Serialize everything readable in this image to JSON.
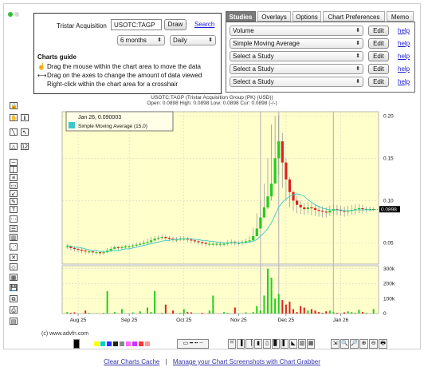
{
  "controls": {
    "symbol_label": "Tristar Acquisition",
    "symbol_value": "USOTC:TAGP",
    "draw_label": "Draw",
    "search_label": "Search",
    "period_value": "6 months",
    "interval_value": "Daily"
  },
  "guide": {
    "title": "Charts guide",
    "lines": [
      "Drag the mouse within the chart area to move the data",
      "Drag on the axes to change the amount of data viewed",
      "Right-click within the chart area for a crosshair"
    ]
  },
  "tabs": [
    "Studies",
    "Overlays",
    "Options",
    "Chart Preferences",
    "Memo"
  ],
  "studies": [
    {
      "value": "Volume",
      "edit": "Edit",
      "help": "help"
    },
    {
      "value": "Simple Moving Average",
      "edit": "Edit",
      "help": "help"
    },
    {
      "value": "Select a Study",
      "edit": "Edit",
      "help": "help"
    },
    {
      "value": "Select a Study",
      "edit": "Edit",
      "help": "help"
    },
    {
      "value": "Select a Study",
      "edit": "Edit",
      "help": "help"
    }
  ],
  "toolbar_icons": [
    "lock-icon",
    "hand-icon",
    "info-icon",
    "line-icon",
    "cursor-icon",
    "triangle-icon",
    "zoom-12-icon",
    "horizontal-line-icon",
    "vertical-line-icon",
    "channel-icon",
    "rectangle-icon",
    "arrow-icon",
    "pen-icon",
    "text-icon",
    "fibonacci-icon",
    "levels-icon",
    "bars-icon",
    "pitchfork-icon",
    "gann-icon",
    "eraser-icon",
    "grid-icon",
    "save-icon",
    "copy-icon",
    "print-icon",
    "layout-icon"
  ],
  "chart_data": {
    "type": "candlestick",
    "title": "USOTC:TAGP (Tristar Acquisition Group (PK) (USD))",
    "ohlc_readout": "Open: 0.0898 High: 0.0898 Low: 0.0898 Cur: 0.0898 (-/-)",
    "legend_date": "Jan 26, 0.090003",
    "legend_series": "Simple Moving Average (15,0)",
    "price_axis": {
      "ticks": [
        "0.20",
        "0.15",
        "0.10",
        "0.05"
      ],
      "ylim": [
        0.025,
        0.205
      ]
    },
    "volume_axis": {
      "ticks": [
        "300k",
        "200k",
        "100k",
        "0"
      ],
      "ylim": [
        0,
        320
      ]
    },
    "x_labels": [
      "Aug 25",
      "Sep 25",
      "Oct 25",
      "Nov 25",
      "Dec 25",
      "Jan 26"
    ],
    "current_price": "0.0898",
    "closes": [
      0.046,
      0.044,
      0.043,
      0.042,
      0.041,
      0.04,
      0.04,
      0.039,
      0.039,
      0.038,
      0.039,
      0.041,
      0.043,
      0.045,
      0.044,
      0.045,
      0.046,
      0.046,
      0.047,
      0.048,
      0.049,
      0.05,
      0.051,
      0.053,
      0.055,
      0.056,
      0.057,
      0.056,
      0.055,
      0.054,
      0.054,
      0.055,
      0.055,
      0.054,
      0.053,
      0.052,
      0.051,
      0.05,
      0.049,
      0.049,
      0.049,
      0.049,
      0.049,
      0.049,
      0.05,
      0.051,
      0.05,
      0.05,
      0.051,
      0.052,
      0.053,
      0.058,
      0.067,
      0.08,
      0.092,
      0.105,
      0.12,
      0.15,
      0.17,
      0.145,
      0.125,
      0.11,
      0.1,
      0.095,
      0.092,
      0.09,
      0.092,
      0.091,
      0.089,
      0.088,
      0.087,
      0.086,
      0.088,
      0.09,
      0.089,
      0.088,
      0.087,
      0.088,
      0.089,
      0.09,
      0.091,
      0.09,
      0.09,
      0.09,
      0.09
    ],
    "highs": [
      0.049,
      0.047,
      0.046,
      0.045,
      0.044,
      0.043,
      0.042,
      0.041,
      0.041,
      0.04,
      0.041,
      0.044,
      0.046,
      0.047,
      0.046,
      0.047,
      0.048,
      0.048,
      0.049,
      0.05,
      0.051,
      0.053,
      0.055,
      0.057,
      0.058,
      0.059,
      0.06,
      0.059,
      0.058,
      0.057,
      0.057,
      0.058,
      0.058,
      0.057,
      0.056,
      0.055,
      0.054,
      0.053,
      0.052,
      0.052,
      0.051,
      0.051,
      0.051,
      0.051,
      0.053,
      0.054,
      0.053,
      0.052,
      0.053,
      0.055,
      0.058,
      0.068,
      0.085,
      0.1,
      0.12,
      0.15,
      0.19,
      0.2,
      0.2,
      0.18,
      0.15,
      0.128,
      0.112,
      0.105,
      0.1,
      0.097,
      0.098,
      0.097,
      0.096,
      0.094,
      0.093,
      0.092,
      0.094,
      0.095,
      0.095,
      0.094,
      0.093,
      0.094,
      0.095,
      0.096,
      0.096,
      0.095,
      0.093,
      0.093,
      0.092
    ],
    "lows": [
      0.043,
      0.041,
      0.04,
      0.039,
      0.038,
      0.037,
      0.037,
      0.036,
      0.036,
      0.035,
      0.036,
      0.038,
      0.04,
      0.042,
      0.041,
      0.042,
      0.043,
      0.043,
      0.044,
      0.045,
      0.046,
      0.047,
      0.048,
      0.05,
      0.052,
      0.053,
      0.054,
      0.053,
      0.052,
      0.051,
      0.051,
      0.052,
      0.052,
      0.051,
      0.05,
      0.049,
      0.048,
      0.047,
      0.046,
      0.046,
      0.046,
      0.046,
      0.046,
      0.046,
      0.047,
      0.048,
      0.047,
      0.047,
      0.048,
      0.049,
      0.05,
      0.053,
      0.06,
      0.07,
      0.08,
      0.09,
      0.1,
      0.12,
      0.13,
      0.115,
      0.1,
      0.092,
      0.088,
      0.085,
      0.084,
      0.083,
      0.084,
      0.083,
      0.082,
      0.081,
      0.08,
      0.08,
      0.082,
      0.083,
      0.083,
      0.082,
      0.081,
      0.082,
      0.083,
      0.084,
      0.085,
      0.085,
      0.086,
      0.087,
      0.088
    ],
    "sma": [
      0.047,
      0.046,
      0.045,
      0.045,
      0.044,
      0.043,
      0.042,
      0.041,
      0.041,
      0.04,
      0.04,
      0.04,
      0.04,
      0.041,
      0.041,
      0.042,
      0.043,
      0.043,
      0.044,
      0.045,
      0.046,
      0.047,
      0.048,
      0.049,
      0.05,
      0.051,
      0.052,
      0.053,
      0.053,
      0.054,
      0.054,
      0.055,
      0.055,
      0.055,
      0.055,
      0.054,
      0.054,
      0.053,
      0.053,
      0.052,
      0.052,
      0.051,
      0.051,
      0.05,
      0.05,
      0.05,
      0.05,
      0.05,
      0.05,
      0.05,
      0.051,
      0.052,
      0.054,
      0.058,
      0.062,
      0.067,
      0.074,
      0.083,
      0.092,
      0.098,
      0.102,
      0.105,
      0.107,
      0.108,
      0.107,
      0.105,
      0.101,
      0.098,
      0.095,
      0.093,
      0.091,
      0.09,
      0.089,
      0.089,
      0.089,
      0.089,
      0.088,
      0.088,
      0.088,
      0.089,
      0.089,
      0.089,
      0.089,
      0.089,
      0.089
    ],
    "volumes": [
      10,
      5,
      8,
      0,
      0,
      20,
      5,
      0,
      2,
      0,
      5,
      150,
      0,
      10,
      0,
      30,
      0,
      0,
      8,
      0,
      15,
      0,
      40,
      10,
      150,
      0,
      5,
      60,
      0,
      20,
      0,
      5,
      30,
      10,
      8,
      0,
      0,
      5,
      0,
      20,
      120,
      0,
      0,
      10,
      5,
      0,
      40,
      0,
      0,
      8,
      0,
      10,
      50,
      20,
      120,
      300,
      240,
      100,
      130,
      90,
      60,
      80,
      30,
      10,
      50,
      40,
      20,
      30,
      20,
      10,
      5,
      15,
      20,
      10,
      5,
      0,
      8,
      15,
      10,
      5,
      25,
      10,
      5,
      0,
      30
    ]
  },
  "copyright": "(c) www.advfn.com",
  "colors": {
    "up": "#22cc22",
    "down": "#e02020",
    "sma": "#3cc8c8",
    "chart_bg": "#ffffcc",
    "flat": "#111111"
  },
  "bottom_palette": [
    "#000000",
    "#ffff00",
    "#00cccc",
    "#3333ff",
    "#222222",
    "#888888",
    "#ff66ff",
    "#cc33ff",
    "#ff3333",
    "#ff9999"
  ],
  "bottom_buttons": [
    "line-style",
    "bar-chart",
    "candle-chart",
    "zoom-in",
    "zoom-out",
    "print"
  ],
  "footer": {
    "clear_cache": "Clear Charts Cache",
    "separator": "|",
    "manage": "Manage your Chart Screenshots with Chart Grabber"
  }
}
